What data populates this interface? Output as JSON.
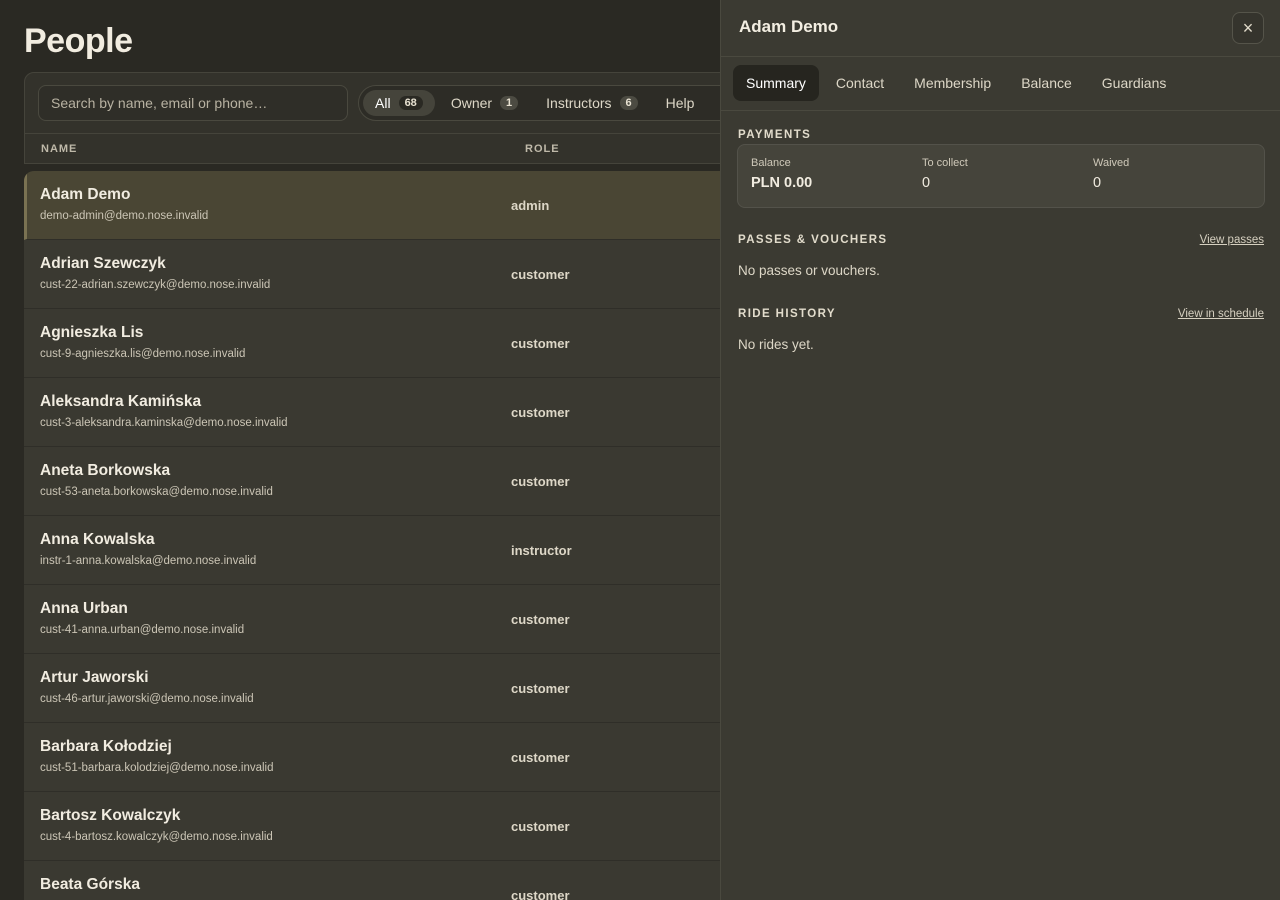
{
  "page": {
    "title": "People"
  },
  "search": {
    "placeholder": "Search by name, email or phone…"
  },
  "filters": [
    {
      "label": "All",
      "count": "68",
      "active": true
    },
    {
      "label": "Owner",
      "count": "1"
    },
    {
      "label": "Instructors",
      "count": "6"
    },
    {
      "label": "Help",
      "count": ""
    }
  ],
  "table": {
    "headers": {
      "name": "NAME",
      "role": "ROLE"
    },
    "rows": [
      {
        "name": "Adam Demo",
        "email": "demo-admin@demo.nose.invalid",
        "role": "admin"
      },
      {
        "name": "Adrian Szewczyk",
        "email": "cust-22-adrian.szewczyk@demo.nose.invalid",
        "role": "customer"
      },
      {
        "name": "Agnieszka Lis",
        "email": "cust-9-agnieszka.lis@demo.nose.invalid",
        "role": "customer"
      },
      {
        "name": "Aleksandra Kamińska",
        "email": "cust-3-aleksandra.kaminska@demo.nose.invalid",
        "role": "customer"
      },
      {
        "name": "Aneta Borkowska",
        "email": "cust-53-aneta.borkowska@demo.nose.invalid",
        "role": "customer"
      },
      {
        "name": "Anna Kowalska",
        "email": "instr-1-anna.kowalska@demo.nose.invalid",
        "role": "instructor"
      },
      {
        "name": "Anna Urban",
        "email": "cust-41-anna.urban@demo.nose.invalid",
        "role": "customer"
      },
      {
        "name": "Artur Jaworski",
        "email": "cust-46-artur.jaworski@demo.nose.invalid",
        "role": "customer"
      },
      {
        "name": "Barbara Kołodziej",
        "email": "cust-51-barbara.kolodziej@demo.nose.invalid",
        "role": "customer"
      },
      {
        "name": "Bartosz Kowalczyk",
        "email": "cust-4-bartosz.kowalczyk@demo.nose.invalid",
        "role": "customer"
      },
      {
        "name": "Beata Górska",
        "email": "",
        "role": "customer"
      }
    ]
  },
  "drawer": {
    "title": "Adam Demo",
    "close_icon": "×",
    "tabs": [
      "Summary",
      "Contact",
      "Membership",
      "Balance",
      "Guardians"
    ],
    "payments": {
      "title": "PAYMENTS",
      "balance_label": "Balance",
      "balance_value": "PLN 0.00",
      "collect_label": "To collect",
      "collect_value": "0",
      "waived_label": "Waived",
      "waived_value": "0"
    },
    "passes": {
      "title": "PASSES & VOUCHERS",
      "link": "View passes",
      "empty": "No passes or vouchers."
    },
    "rides": {
      "title": "RIDE HISTORY",
      "link": "View in schedule",
      "empty": "No rides yet."
    }
  }
}
